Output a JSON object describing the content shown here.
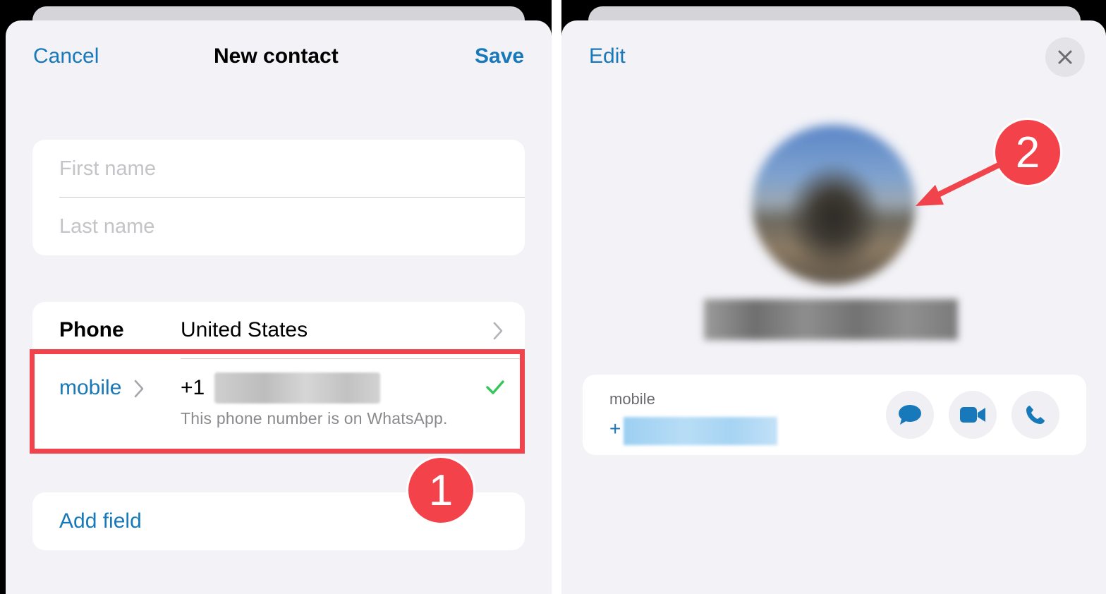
{
  "left": {
    "nav": {
      "cancel": "Cancel",
      "title": "New contact",
      "save": "Save"
    },
    "name_fields": {
      "first_placeholder": "First name",
      "last_placeholder": "Last name"
    },
    "phone_section": {
      "label": "Phone",
      "country": "United States",
      "type_label": "mobile",
      "country_code": "+1",
      "whatsapp_hint": "This phone number is on WhatsApp."
    },
    "add_field": "Add field",
    "callout_number": "1"
  },
  "right": {
    "nav": {
      "edit": "Edit"
    },
    "phone_card": {
      "type_label": "mobile",
      "prefix": "+"
    },
    "callout_number": "2"
  },
  "colors": {
    "accent": "#1778ba",
    "highlight": "#f0434b",
    "badge": "#f4424a",
    "check": "#34c759",
    "sheet_bg": "#f2f2f7"
  },
  "icons": {
    "close": "close-icon",
    "chevron": "chevron-right-icon",
    "check": "checkmark-icon",
    "message": "message-icon",
    "video": "video-icon",
    "call": "phone-icon"
  }
}
